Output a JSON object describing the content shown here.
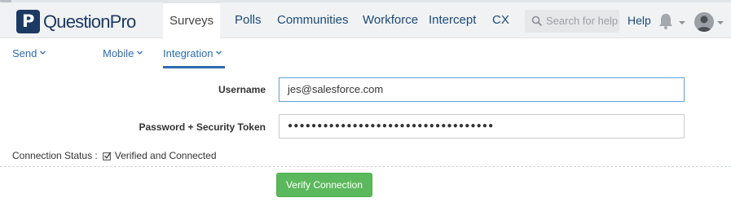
{
  "brand": {
    "name": "QuestionPro",
    "mark_letter": "P",
    "color": "#1d3a64"
  },
  "nav": {
    "items": [
      {
        "label": "Surveys",
        "active": true
      },
      {
        "label": "Polls",
        "active": false
      },
      {
        "label": "Communities",
        "active": false
      },
      {
        "label": "Workforce",
        "active": false
      },
      {
        "label": "Intercept",
        "active": false
      },
      {
        "label": "CX",
        "active": false
      }
    ],
    "search_placeholder": "Search for help",
    "help_label": "Help"
  },
  "icons": {
    "search": "search-icon",
    "bell": "bell-icon",
    "avatar": "user-avatar-icon",
    "chevron": "chevron-down-icon",
    "check": "checkbox-checked-icon"
  },
  "subnav": {
    "send": "Send",
    "mobile": "Mobile",
    "integration": "Integration",
    "active": "Integration"
  },
  "form": {
    "username_label": "Username",
    "username_value": "jes@salesforce.com",
    "password_label": "Password + Security Token",
    "password_value": "●●●●●●●●●●●●●●●●●●●●●●●●●●●●●●●●●●●"
  },
  "connection": {
    "label": "Connection Status :",
    "value": "Verified and Connected"
  },
  "actions": {
    "verify_label": "Verify Connection"
  },
  "colors": {
    "accent": "#2b6cb0",
    "button": "#5cb85c",
    "nav_text": "#1b4a7a"
  }
}
